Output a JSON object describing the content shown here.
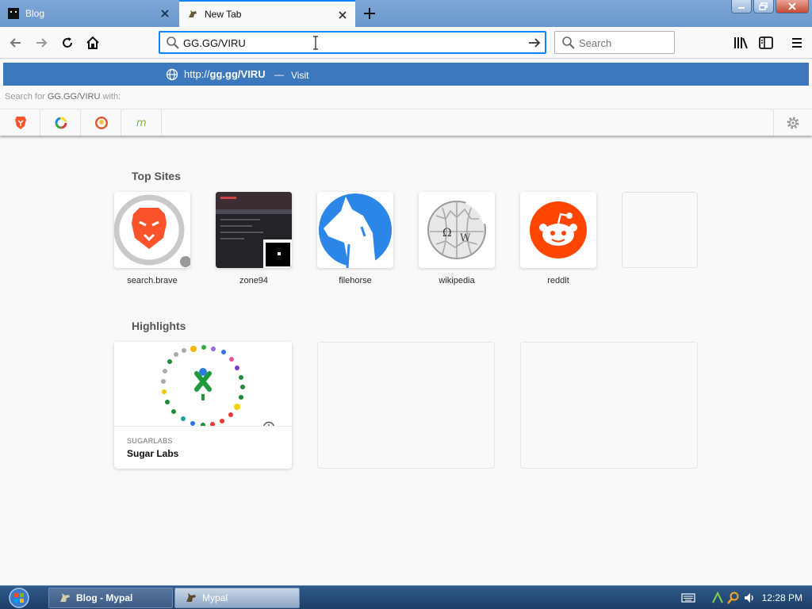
{
  "tabs": [
    {
      "title": "Blog",
      "active": false,
      "icon": "pixel-face-icon"
    },
    {
      "title": "New Tab",
      "active": true,
      "icon": "horse-icon"
    }
  ],
  "navbar": {
    "url_value": "GG.GG/VIRU",
    "search_placeholder": "Search"
  },
  "dropdown": {
    "suggestion_scheme": "http://",
    "suggestion_host": "gg.gg/VIRU",
    "separator": "—",
    "action": "Visit",
    "search_for_prefix": "Search for",
    "search_for_query": "GG.GG/VIRU",
    "search_for_suffix": "with:",
    "engines": [
      "brave-search-icon",
      "qwant-icon",
      "duckduckgo-icon",
      "mojeek-icon"
    ]
  },
  "top_sites": {
    "title": "Top Sites",
    "items": [
      {
        "label": "search.brave",
        "icon": "brave-lion-icon"
      },
      {
        "label": "zone94",
        "icon": "screenshot-thumbnail"
      },
      {
        "label": "filehorse",
        "icon": "horse-logo-icon"
      },
      {
        "label": "wikipedia",
        "icon": "wikipedia-globe-icon"
      },
      {
        "label": "reddit",
        "icon": "reddit-alien-icon"
      },
      {
        "label": "",
        "icon": ""
      }
    ]
  },
  "highlights": {
    "title": "Highlights",
    "items": [
      {
        "source": "SUGARLABS",
        "title": "Sugar Labs",
        "icon": "clock-icon"
      }
    ]
  },
  "taskbar": {
    "buttons": [
      "Blog - Mypal",
      "Mypal"
    ],
    "clock": "12:28 PM"
  },
  "colors": {
    "accent": "#0a84ff",
    "dropdown_highlight": "#3d78bd",
    "tabstrip": "#7ea7d6",
    "taskbar": "#2a5282"
  }
}
